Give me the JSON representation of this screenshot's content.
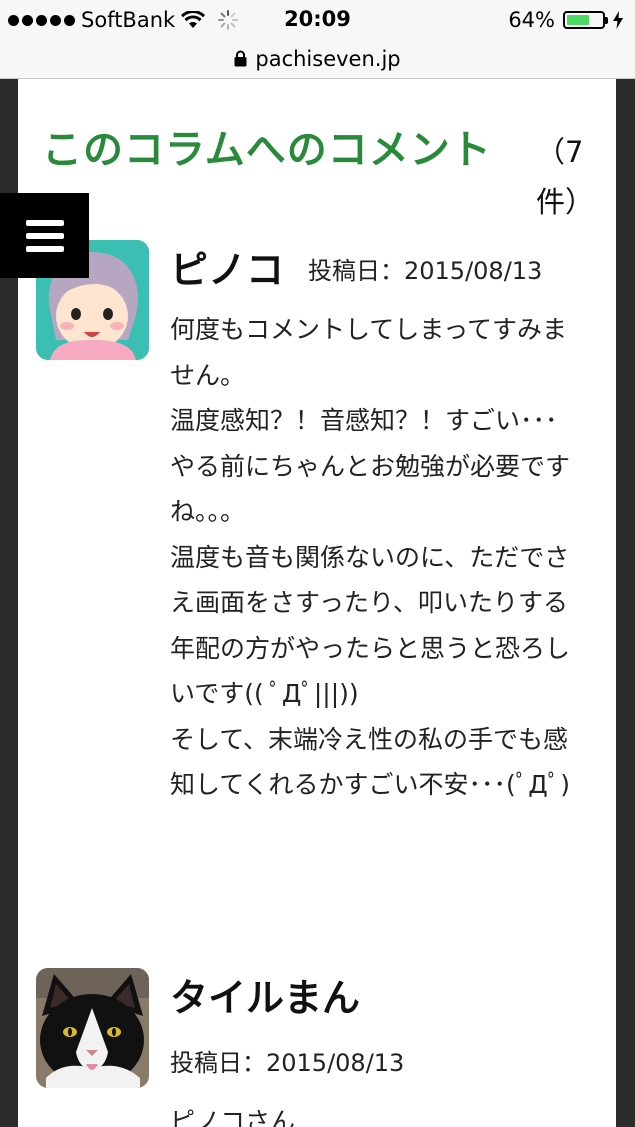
{
  "status_bar": {
    "carrier": "SoftBank",
    "time": "20:09",
    "battery_percent_label": "64%",
    "battery_level": 0.64,
    "battery_color": "#4cd964"
  },
  "browser": {
    "url": "pachiseven.jp"
  },
  "page": {
    "section_title": "このコラムへのコメント",
    "section_count": "（7件）",
    "accent_color": "#2a8a3b",
    "menu_icon": "hamburger-menu-icon"
  },
  "comments": [
    {
      "name": "ピノコ",
      "date": "投稿日：2015/08/13",
      "avatar": "girl-avatar",
      "body": [
        "何度もコメントしてしまってすみません。",
        "温度感知？！音感知？！すごい･･･",
        "やる前にちゃんとお勉強が必要ですね。。。",
        "温度も音も関係ないのに、ただでさえ画面をさすったり、叩いたりする",
        "年配の方がやったらと思うと恐ろしいです(( ﾟДﾟ|||))",
        "そして、末端冷え性の私の手でも感知してくれるかすごい不安･･･(ﾟДﾟ)"
      ]
    },
    {
      "name": "タイルまん",
      "date": "投稿日：2015/08/13",
      "avatar": "cat-avatar",
      "body": [
        "ピノコさん"
      ]
    }
  ]
}
